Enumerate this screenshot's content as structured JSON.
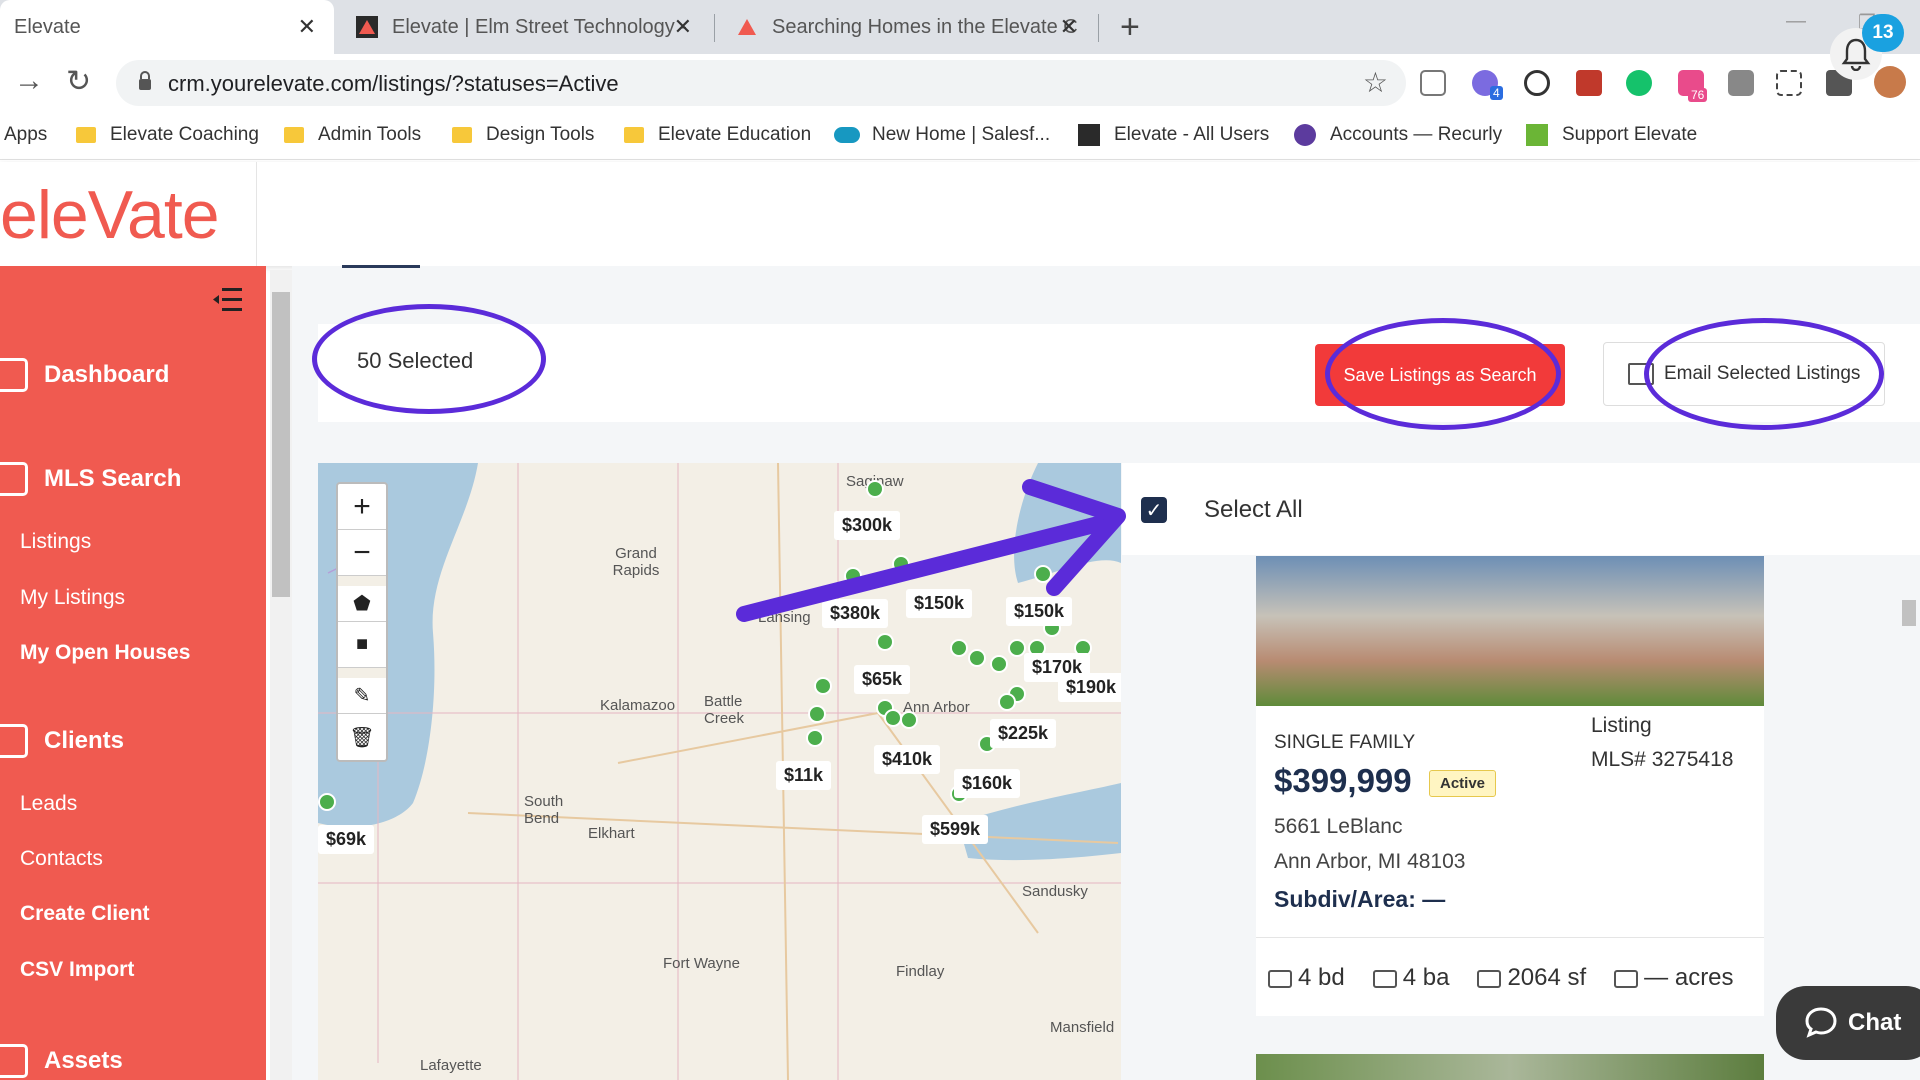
{
  "browser": {
    "tabs": [
      {
        "title": "Elevate"
      },
      {
        "title": "Elevate | Elm Street Technology -"
      },
      {
        "title": "Searching Homes in the Elevate C"
      }
    ],
    "url": "crm.yourelevate.com/listings/?statuses=Active",
    "bookmarks": [
      {
        "label": "Apps"
      },
      {
        "label": "Elevate Coaching"
      },
      {
        "label": "Admin Tools"
      },
      {
        "label": "Design Tools"
      },
      {
        "label": "Elevate Education"
      },
      {
        "label": "New Home | Salesf..."
      },
      {
        "label": "Elevate - All Users"
      },
      {
        "label": "Accounts — Recurly"
      },
      {
        "label": "Support Elevate"
      }
    ],
    "ext_badges": {
      "blue": "4",
      "pink": "76"
    }
  },
  "header": {
    "logo": "eleVate",
    "notification_count": "13"
  },
  "sidebar": {
    "sections": [
      {
        "label": "Dashboard"
      },
      {
        "label": "MLS Search"
      },
      {
        "label": "Clients"
      },
      {
        "label": "Assets"
      }
    ],
    "items": [
      {
        "label": "Listings"
      },
      {
        "label": "My Listings"
      },
      {
        "label": "My Open Houses"
      },
      {
        "label": "Leads"
      },
      {
        "label": "Contacts"
      },
      {
        "label": "Create Client"
      },
      {
        "label": "CSV Import"
      }
    ]
  },
  "selection": {
    "count_label": "50 Selected",
    "save_button": "Save Listings as Search",
    "email_button": "Email Selected Listings",
    "select_all": "Select All"
  },
  "map": {
    "cities": [
      "Saginaw",
      "Grand Rapids",
      "Lansing",
      "Kalamazoo",
      "Battle Creek",
      "Ann Arbor",
      "South Bend",
      "Elkhart",
      "Fort Wayne",
      "Findlay",
      "Sandusky",
      "Mansfield",
      "Lafayette"
    ],
    "prices": [
      "$300k",
      "$380k",
      "$150k",
      "$150k",
      "$65k",
      "$170k",
      "$190k",
      "$225k",
      "$410k",
      "$11k",
      "$160k",
      "$599k",
      "$69k"
    ]
  },
  "listing": {
    "type": "SINGLE FAMILY",
    "price": "$399,999",
    "status": "Active",
    "listing_label": "Listing",
    "mls": "MLS# 3275418",
    "address": "5661 LeBlanc",
    "city": "Ann Arbor, MI 48103",
    "subdiv": "Subdiv/Area: —",
    "beds": "4 bd",
    "baths": "4 ba",
    "sqft": "2064 sf",
    "acres": "— acres"
  },
  "chat": {
    "label": "Chat"
  },
  "colors": {
    "brand": "#f05a50",
    "accent_red": "#f23a3a",
    "annotation": "#5b2bd9",
    "navy": "#1e2f4e"
  }
}
